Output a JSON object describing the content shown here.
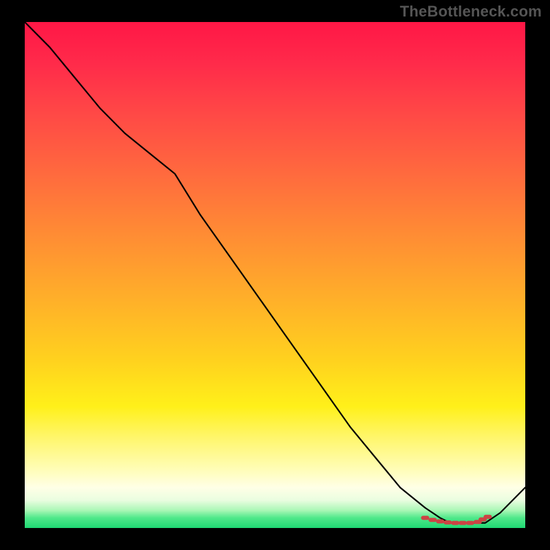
{
  "watermark": "TheBottleneck.com",
  "colors": {
    "bg": "#000000",
    "line": "#000000",
    "marker": "#cc4444",
    "gradient_top": "#ff1746",
    "gradient_mid": "#ffd21e",
    "gradient_bottom": "#1fd873"
  },
  "chart_data": {
    "type": "line",
    "title": "",
    "xlabel": "",
    "ylabel": "",
    "xlim": [
      0,
      100
    ],
    "ylim": [
      0,
      100
    ],
    "x": [
      0,
      5,
      10,
      15,
      20,
      25,
      30,
      35,
      40,
      45,
      50,
      55,
      60,
      65,
      70,
      75,
      80,
      83,
      85,
      88,
      90,
      92,
      95,
      100
    ],
    "values": [
      100,
      95,
      89,
      83,
      78,
      74,
      70,
      62,
      55,
      48,
      41,
      34,
      27,
      20,
      14,
      8,
      4,
      2,
      1,
      1,
      1,
      1,
      3,
      8
    ],
    "markers_x": [
      80,
      81.5,
      83,
      84.5,
      86,
      87.5,
      89,
      90.5,
      91.5,
      92.5
    ],
    "markers_y": [
      2.0,
      1.6,
      1.3,
      1.1,
      1.0,
      1.0,
      1.0,
      1.2,
      1.7,
      2.2
    ]
  }
}
